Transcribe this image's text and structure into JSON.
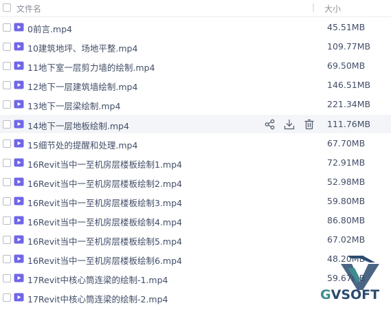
{
  "header": {
    "name_label": "文件名",
    "size_label": "大小"
  },
  "files": [
    {
      "name": "0前言.mp4",
      "size": "45.51MB"
    },
    {
      "name": "10建筑地坪、场地平整.mp4",
      "size": "109.77MB"
    },
    {
      "name": "11地下室一层剪力墙的绘制.mp4",
      "size": "69.50MB"
    },
    {
      "name": "12地下一层建筑墙绘制.mp4",
      "size": "146.51MB"
    },
    {
      "name": "13地下一层梁绘制.mp4",
      "size": "221.34MB"
    },
    {
      "name": "14地下一层地板绘制.mp4",
      "size": "111.76MB",
      "hovered": true
    },
    {
      "name": "15细节处的提醒和处理.mp4",
      "size": "67.70MB"
    },
    {
      "name": "16Revit当中一至机房层楼板绘制1.mp4",
      "size": "72.91MB"
    },
    {
      "name": "16Revit当中一至机房层楼板绘制2.mp4",
      "size": "52.98MB"
    },
    {
      "name": "16Revit当中一至机房层楼板绘制3.mp4",
      "size": "59.80MB"
    },
    {
      "name": "16Revit当中一至机房层楼板绘制4.mp4",
      "size": "86.80MB"
    },
    {
      "name": "16Revit当中一至机房层楼板绘制5.mp4",
      "size": "67.02MB"
    },
    {
      "name": "16Revit当中一至机房层楼板绘制6.mp4",
      "size": "48.20MB"
    },
    {
      "name": "17Revit中核心筒连梁的绘制-1.mp4",
      "size": "59.67MB"
    },
    {
      "name": "17Revit中核心筒连梁的绘制-2.mp4",
      "size": ""
    }
  ],
  "row_actions": [
    "share-icon",
    "download-icon",
    "delete-icon"
  ],
  "watermark": {
    "text_a": "G",
    "text_b": "VSOFT"
  },
  "colors": {
    "video_icon": "#6f66e8",
    "hover_row": "#f4f5f8",
    "text": "#424e67"
  }
}
